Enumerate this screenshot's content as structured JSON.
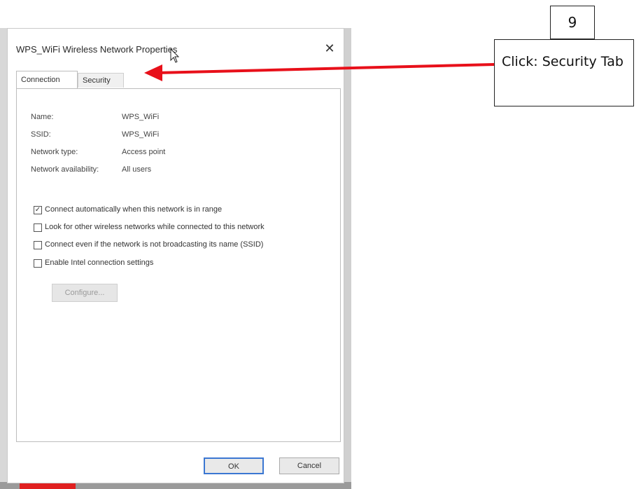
{
  "dialog": {
    "title": "WPS_WiFi Wireless Network Properties",
    "close_glyph": "✕",
    "tabs": [
      {
        "label": "Connection"
      },
      {
        "label": "Security"
      }
    ],
    "info": [
      {
        "label": "Name:",
        "value": "WPS_WiFi"
      },
      {
        "label": "SSID:",
        "value": "WPS_WiFi"
      },
      {
        "label": "Network type:",
        "value": "Access point"
      },
      {
        "label": "Network availability:",
        "value": "All users"
      }
    ],
    "options": [
      {
        "label": "Connect automatically when this network is in range",
        "checked": true
      },
      {
        "label": "Look for other wireless networks while connected to this network",
        "checked": false
      },
      {
        "label": "Connect even if the network is not broadcasting its name (SSID)",
        "checked": false
      },
      {
        "label": "Enable Intel connection settings",
        "checked": false
      }
    ],
    "configure_label": "Configure...",
    "ok_label": "OK",
    "cancel_label": "Cancel"
  },
  "callout": {
    "step_number": "9",
    "text": "Click: Security Tab",
    "arrow_color": "#e8101a"
  }
}
